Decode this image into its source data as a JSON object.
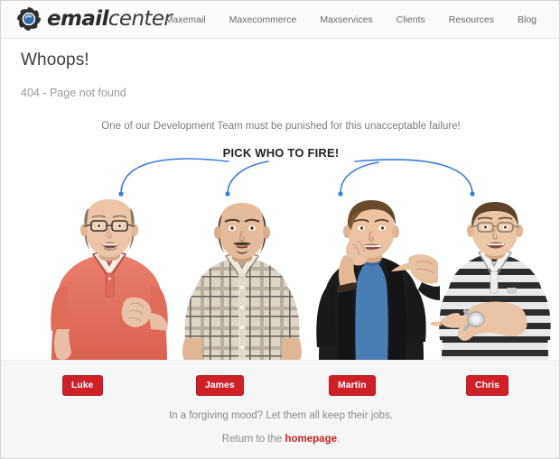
{
  "header": {
    "logo": {
      "icon": "swirl-pinwheel-icon",
      "text_bold": "email",
      "text_light": "center",
      "accent_color": "#2a6fb5"
    },
    "nav_items": [
      {
        "label": "Maxemail"
      },
      {
        "label": "Maxecommerce"
      },
      {
        "label": "Maxservices"
      },
      {
        "label": "Clients"
      },
      {
        "label": "Resources"
      },
      {
        "label": "Blog"
      }
    ]
  },
  "main": {
    "title": "Whoops!",
    "subtitle": "404 - Page not found",
    "prompt": "One of our Development Team must be punished for this unacceptable failure!",
    "pick_label": "PICK WHO TO FIRE!",
    "arrow_color": "#3b7dd8",
    "people": [
      {
        "name": "Luke",
        "description": "balding man with glasses in coral polo shirt, hands raised shrugging",
        "shirt_color": "#e2705f"
      },
      {
        "name": "James",
        "description": "bald man with goatee in beige plaid checked shirt, arms out",
        "shirt_color": "#ddd5c5"
      },
      {
        "name": "Martin",
        "description": "young man with brown hair in black jacket over blue t-shirt, biting nails",
        "shirt_color": "#4a7fb5"
      },
      {
        "name": "Chris",
        "description": "man with glasses in black and white striped polo, pointing left, wearing watch",
        "shirt_color": "#e6e6e6"
      }
    ]
  },
  "footer": {
    "buttons": [
      {
        "label": "Luke"
      },
      {
        "label": "James"
      },
      {
        "label": "Martin"
      },
      {
        "label": "Chris"
      }
    ],
    "button_color": "#cf2027",
    "forgive_text": "In a forgiving mood? Let them all keep their jobs.",
    "return_prefix": "Return to the ",
    "return_link": "homepage",
    "return_suffix": "."
  }
}
